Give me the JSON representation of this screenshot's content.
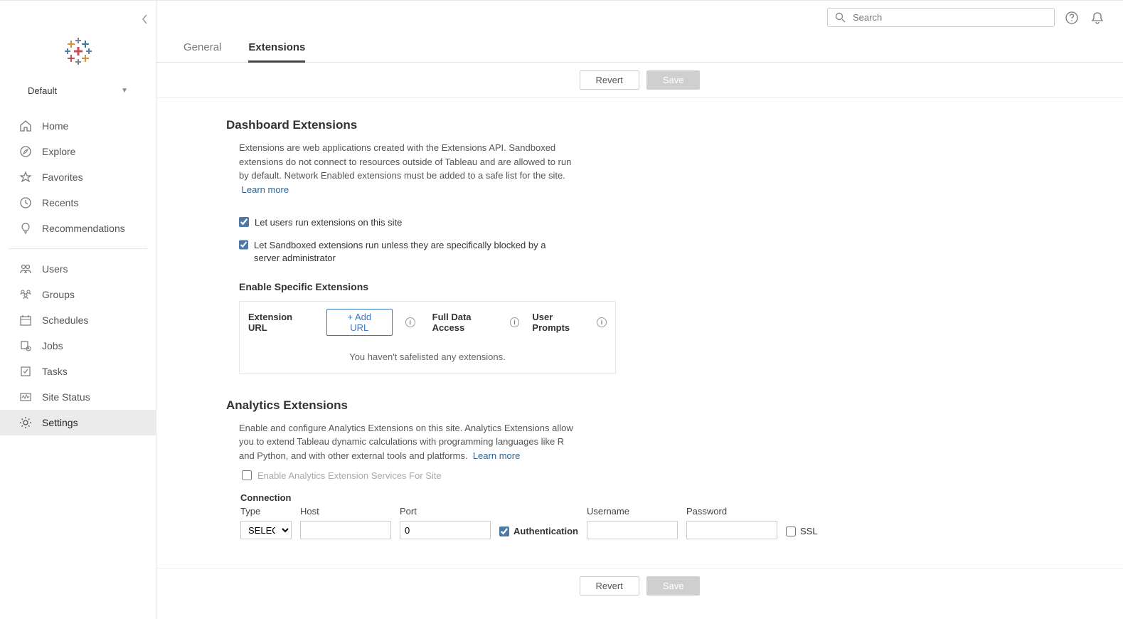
{
  "sidebar": {
    "site": "Default",
    "items": [
      {
        "label": "Home"
      },
      {
        "label": "Explore"
      },
      {
        "label": "Favorites"
      },
      {
        "label": "Recents"
      },
      {
        "label": "Recommendations"
      },
      {
        "label": "Users"
      },
      {
        "label": "Groups"
      },
      {
        "label": "Schedules"
      },
      {
        "label": "Jobs"
      },
      {
        "label": "Tasks"
      },
      {
        "label": "Site Status"
      },
      {
        "label": "Settings"
      }
    ]
  },
  "search": {
    "placeholder": "Search"
  },
  "tabs": {
    "general": "General",
    "extensions": "Extensions"
  },
  "actions": {
    "revert": "Revert",
    "save": "Save"
  },
  "dashboard": {
    "title": "Dashboard Extensions",
    "desc": "Extensions are web applications created with the Extensions API. Sandboxed extensions do not connect to resources outside of Tableau and are allowed to run by default. Network Enabled extensions must be added to a safe list for the site.",
    "learn": "Learn more",
    "cb1": "Let users run extensions on this site",
    "cb2": "Let Sandboxed extensions run unless they are specifically blocked by a server administrator",
    "enable_title": "Enable Specific Extensions",
    "col_url": "Extension URL",
    "add_url": "+ Add URL",
    "col_full": "Full Data Access",
    "col_prompts": "User Prompts",
    "empty": "You haven't safelisted any extensions."
  },
  "analytics": {
    "title": "Analytics Extensions",
    "desc": "Enable and configure Analytics Extensions on this site. Analytics Extensions allow you to extend Tableau dynamic calculations with programming languages like R and Python, and with other external tools and platforms.",
    "learn": "Learn more",
    "cb": "Enable Analytics Extension Services For Site",
    "connection": "Connection",
    "type": "Type",
    "type_value": "SELECT",
    "host": "Host",
    "port": "Port",
    "port_value": "0",
    "auth": "Authentication",
    "user": "Username",
    "pass": "Password",
    "ssl": "SSL"
  }
}
